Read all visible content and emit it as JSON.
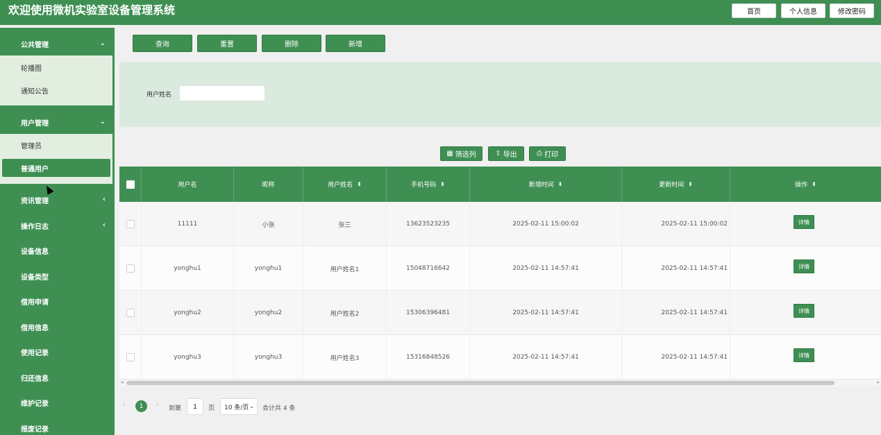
{
  "header": {
    "title": "欢迎使用微机实验室设备管理系统",
    "buttons": [
      "首页",
      "个人信息",
      "修改密码"
    ]
  },
  "sidebar": {
    "groups": [
      {
        "label": "公共管理",
        "arrow": "⌄"
      },
      {
        "label": "用户管理",
        "arrow": "⌄"
      },
      {
        "label": "资讯管理",
        "arrow": "‹"
      },
      {
        "label": "操作日志",
        "arrow": "‹"
      },
      {
        "label": "设备信息"
      },
      {
        "label": "设备类型"
      },
      {
        "label": "借用申请"
      },
      {
        "label": "借用信息"
      },
      {
        "label": "使用记录"
      },
      {
        "label": "归还信息"
      },
      {
        "label": "维护记录"
      },
      {
        "label": "报废记录"
      }
    ],
    "public_items": [
      "轮播图",
      "通知公告"
    ],
    "user_items": [
      "管理员",
      "普通用户"
    ]
  },
  "toolbar": {
    "query": "查询",
    "reset": "重置",
    "delete": "删除",
    "add": "新增"
  },
  "search": {
    "label": "用户姓名",
    "value": ""
  },
  "table_tools": {
    "filter": "筛选列",
    "export": "导出",
    "print": "打印"
  },
  "table": {
    "columns": [
      "用户名",
      "昵称",
      "用户姓名",
      "手机号码",
      "新增时间",
      "更新时间",
      "操作"
    ],
    "rows": [
      {
        "username": "11111",
        "nickname": "小张",
        "name": "张三",
        "phone": "13623523235",
        "created": "2025-02-11 15:00:02",
        "updated": "2025-02-11 15:00:02",
        "action": "详情"
      },
      {
        "username": "yonghu1",
        "nickname": "yonghu1",
        "name": "用户姓名1",
        "phone": "15048716642",
        "created": "2025-02-11 14:57:41",
        "updated": "2025-02-11 14:57:41",
        "action": "详情"
      },
      {
        "username": "yonghu2",
        "nickname": "yonghu2",
        "name": "用户姓名2",
        "phone": "15306396481",
        "created": "2025-02-11 14:57:41",
        "updated": "2025-02-11 14:57:41",
        "action": "详情"
      },
      {
        "username": "yonghu3",
        "nickname": "yonghu3",
        "name": "用户姓名3",
        "phone": "15316848526",
        "created": "2025-02-11 14:57:41",
        "updated": "2025-02-11 14:57:41",
        "action": "详情"
      }
    ]
  },
  "pagination": {
    "current": "1",
    "goto_label": "到第",
    "goto_value": "1",
    "page_label": "页",
    "page_size": "10 条/页",
    "total": "合计共 4 条"
  },
  "colors": {
    "primary": "#3f8f53",
    "panel": "#dbeadf",
    "submenu": "#e2efe0"
  }
}
